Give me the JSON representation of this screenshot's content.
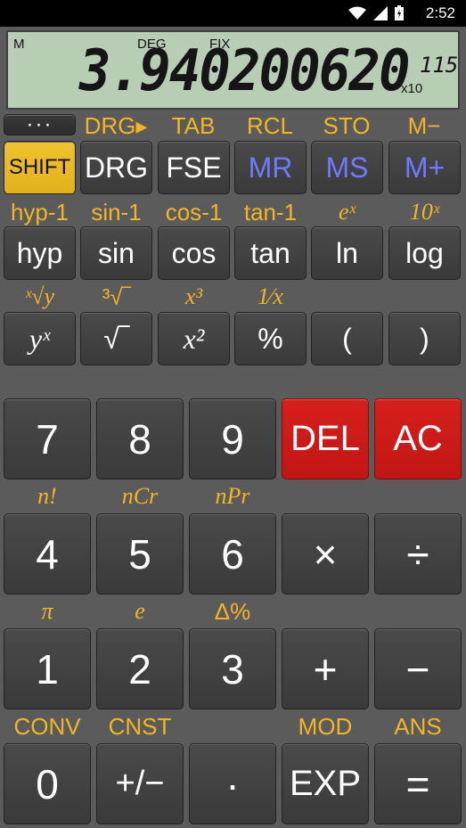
{
  "status": {
    "time": "2:52"
  },
  "display": {
    "memory": "M",
    "angle": "DEG",
    "format": "FIX",
    "value": "3.940200620",
    "exponent": "115",
    "x10": "x10"
  },
  "row1": {
    "labels": [
      "DRG▸",
      "TAB",
      "RCL",
      "STO",
      "M−"
    ],
    "buttons": [
      "SHIFT",
      "DRG",
      "FSE",
      "MR",
      "MS",
      "M+"
    ],
    "dots": "···"
  },
  "row2": {
    "labels": [
      "hyp-1",
      "sin-1",
      "cos-1",
      "tan-1",
      "eˣ",
      "10ˣ"
    ],
    "buttons": [
      "hyp",
      "sin",
      "cos",
      "tan",
      "ln",
      "log"
    ]
  },
  "row3": {
    "labels": [
      "ˣ√y",
      "³√‾",
      "x³",
      "1⁄x"
    ],
    "buttons": [
      "yˣ",
      "√‾",
      "x²",
      "%",
      "(",
      ")"
    ]
  },
  "num1": {
    "buttons": [
      "7",
      "8",
      "9",
      "DEL",
      "AC"
    ]
  },
  "num2": {
    "labels": [
      "n!",
      "nCr",
      "nPr"
    ],
    "buttons": [
      "4",
      "5",
      "6",
      "×",
      "÷"
    ]
  },
  "num3": {
    "labels": [
      "π",
      "e",
      "Δ%"
    ],
    "buttons": [
      "1",
      "2",
      "3",
      "+",
      "−"
    ]
  },
  "num4": {
    "labels": [
      "CONV",
      "CNST",
      "MOD",
      "ANS"
    ],
    "buttons": [
      "0",
      "+/−",
      "·",
      "EXP",
      "="
    ]
  },
  "colors": {
    "accent": "#f2b625",
    "shift": "#e8b923",
    "danger": "#cf1d19",
    "memory": "#6f7bff",
    "lcd": "#b7cdb4"
  }
}
